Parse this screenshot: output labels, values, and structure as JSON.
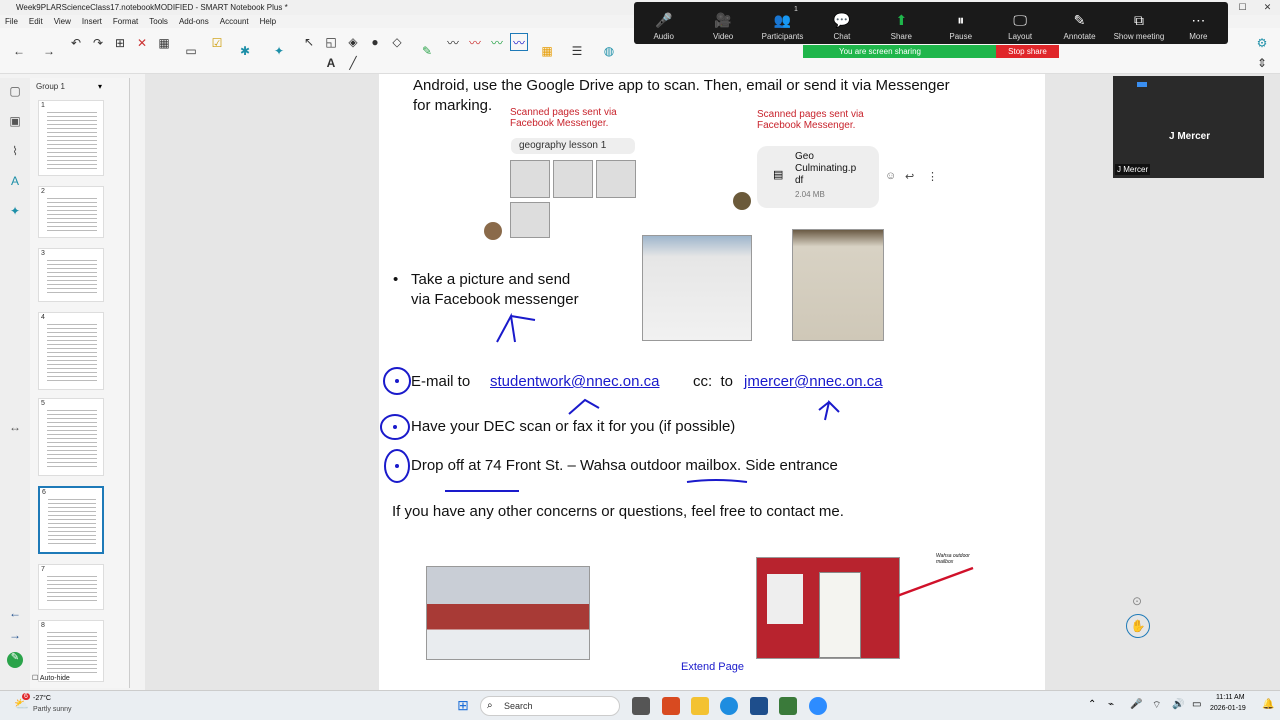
{
  "window": {
    "title": "Week9PLARScienceClass17.notebookMODIFIED - SMART Notebook Plus *"
  },
  "menu": [
    "File",
    "Edit",
    "View",
    "Insert",
    "Format",
    "Tools",
    "Add-ons",
    "Account",
    "Help"
  ],
  "sidebar": {
    "group_label": "Group 1",
    "autohide_label": "Auto-hide",
    "thumbnails": [
      {
        "num": "1"
      },
      {
        "num": "2"
      },
      {
        "num": "3"
      },
      {
        "num": "4"
      },
      {
        "num": "5"
      },
      {
        "num": "6"
      },
      {
        "num": "7"
      },
      {
        "num": "8"
      }
    ]
  },
  "slide": {
    "line1": "Android, use the Google Drive app to scan. Then, email or send it via Messenger",
    "line2": "for marking.",
    "caption_left": "Scanned pages sent via\nFacebook Messenger.",
    "caption_right": "Scanned pages sent via\nFacebook Messenger.",
    "msg_title": "geography lesson 1",
    "file_name": "Geo\nCulminating.p\ndf",
    "file_size": "2.04 MB",
    "bullet": "Take a picture and send\nvia Facebook messenger",
    "email_prefix": "E-mail to",
    "email1": "studentwork@nnec.on.ca",
    "cc": "cc:  to",
    "email2": "jmercer@nnec.on.ca",
    "dec": "Have your DEC scan or fax it for you (if possible)",
    "dropoff": "Drop off at 74 Front St. – Wahsa outdoor mailbox. Side entrance",
    "concerns": "If you have any other concerns or questions, feel free to contact me.",
    "mailbox_label": "Wahsa outdoor\nmailbox",
    "extend": "Extend Page"
  },
  "zoom": {
    "items": [
      {
        "icon": "🎤",
        "label": "Audio"
      },
      {
        "icon": "🎥",
        "label": "Video"
      },
      {
        "icon": "👥",
        "label": "Participants"
      },
      {
        "icon": "💬",
        "label": "Chat"
      },
      {
        "icon": "⬆",
        "label": "Share"
      },
      {
        "icon": "⏸",
        "label": "Pause"
      },
      {
        "icon": "🖵",
        "label": "Layout"
      },
      {
        "icon": "✎",
        "label": "Annotate"
      },
      {
        "icon": "⧉",
        "label": "Show meeting"
      },
      {
        "icon": "⋯",
        "label": "More"
      }
    ],
    "participants_count": "1",
    "sharing": "You are screen sharing",
    "stop": "Stop share",
    "video_name": "J Mercer",
    "video_label": "J Mercer"
  },
  "taskbar": {
    "weather_temp": "-27°C",
    "weather_desc": "Partly sunny",
    "search": "Search",
    "time": "11:11 AM",
    "date": "2026-01-19",
    "badge": "6"
  }
}
